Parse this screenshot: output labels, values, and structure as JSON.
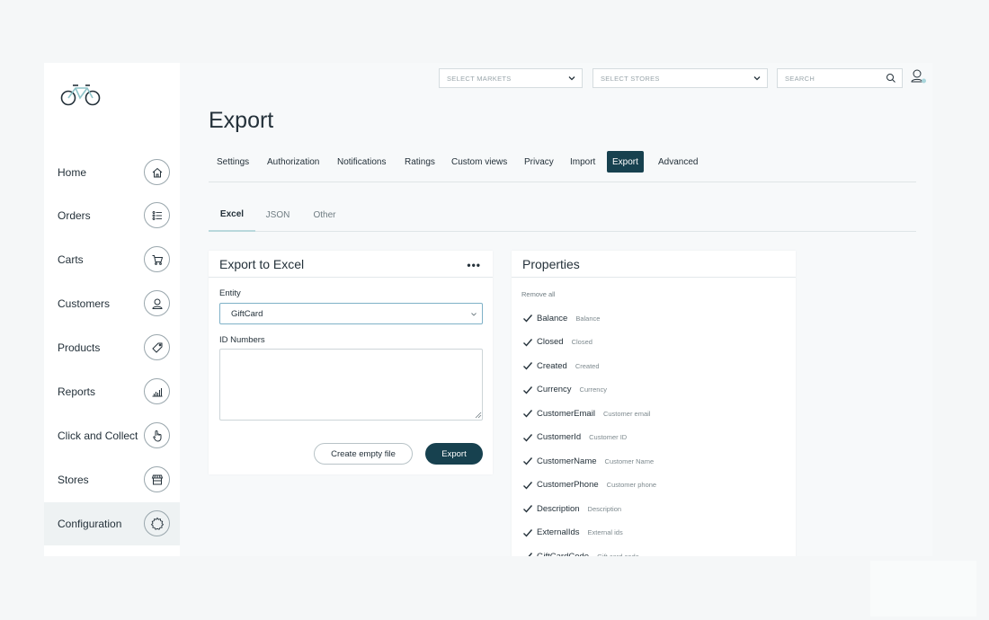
{
  "topbar": {
    "markets_placeholder": "SELECT MARKETS",
    "stores_placeholder": "SELECT STORES",
    "search_placeholder": "SEARCH"
  },
  "sidebar": {
    "items": [
      {
        "label": "Home",
        "icon": "home-icon"
      },
      {
        "label": "Orders",
        "icon": "list-icon"
      },
      {
        "label": "Carts",
        "icon": "cart-icon"
      },
      {
        "label": "Customers",
        "icon": "user-icon"
      },
      {
        "label": "Products",
        "icon": "tag-icon"
      },
      {
        "label": "Reports",
        "icon": "bar-chart-icon"
      },
      {
        "label": "Click and Collect",
        "icon": "hand-pointer-icon"
      },
      {
        "label": "Stores",
        "icon": "storefront-icon"
      },
      {
        "label": "Configuration",
        "icon": "gear-icon"
      }
    ],
    "active": "Configuration"
  },
  "page": {
    "title": "Export"
  },
  "tabs": [
    "Settings",
    "Authorization",
    "Notifications",
    "Ratings",
    "Custom views",
    "Privacy",
    "Import",
    "Export",
    "Advanced"
  ],
  "active_tab": "Export",
  "subtabs": [
    "Excel",
    "JSON",
    "Other"
  ],
  "active_subtab": "Excel",
  "export_card": {
    "title": "Export to Excel",
    "entity_label": "Entity",
    "entity_value": "GiftCard",
    "id_label": "ID Numbers",
    "id_value": "",
    "create_empty_label": "Create empty file",
    "export_label": "Export"
  },
  "properties_card": {
    "title": "Properties",
    "remove_all": "Remove all",
    "items": [
      {
        "name": "Balance",
        "desc": "Balance",
        "checked": true
      },
      {
        "name": "Closed",
        "desc": "Closed",
        "checked": true
      },
      {
        "name": "Created",
        "desc": "Created",
        "checked": true
      },
      {
        "name": "Currency",
        "desc": "Currency",
        "checked": true
      },
      {
        "name": "CustomerEmail",
        "desc": "Customer email",
        "checked": true
      },
      {
        "name": "CustomerId",
        "desc": "Customer ID",
        "checked": true
      },
      {
        "name": "CustomerName",
        "desc": "Customer Name",
        "checked": true
      },
      {
        "name": "CustomerPhone",
        "desc": "Customer phone",
        "checked": true
      },
      {
        "name": "Description",
        "desc": "Description",
        "checked": true
      },
      {
        "name": "ExternalIds",
        "desc": "External ids",
        "checked": true
      },
      {
        "name": "GiftCardCode",
        "desc": "Gift card code",
        "checked": true
      }
    ]
  },
  "colors": {
    "accent": "#17414f",
    "focus_border": "#7fb1c7",
    "subtab_underline": "#b9d8dc"
  }
}
